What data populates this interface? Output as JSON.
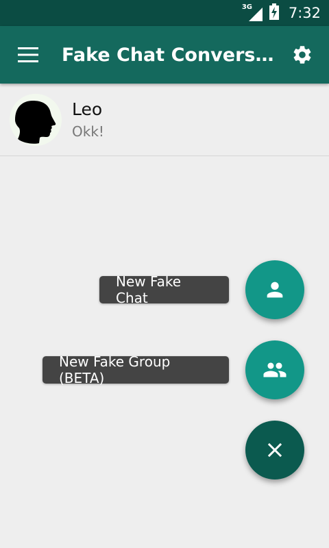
{
  "status_bar": {
    "network_label": "3G",
    "time": "7:32"
  },
  "app_bar": {
    "title": "Fake Chat Conversati…",
    "menu_icon": "hamburger-menu-icon",
    "settings_icon": "gear-icon"
  },
  "chats": [
    {
      "name": "Leo",
      "last_message": "Okk!"
    }
  ],
  "fab_menu": {
    "new_chat_label": "New Fake Chat",
    "new_group_label": "New Fake Group (BETA)",
    "close_icon": "close-icon"
  },
  "colors": {
    "status_bar": "#0b4c43",
    "app_bar": "#14695d",
    "fab_mini": "#129788",
    "fab_main": "#0b5a4f",
    "label_bg": "#444444"
  }
}
